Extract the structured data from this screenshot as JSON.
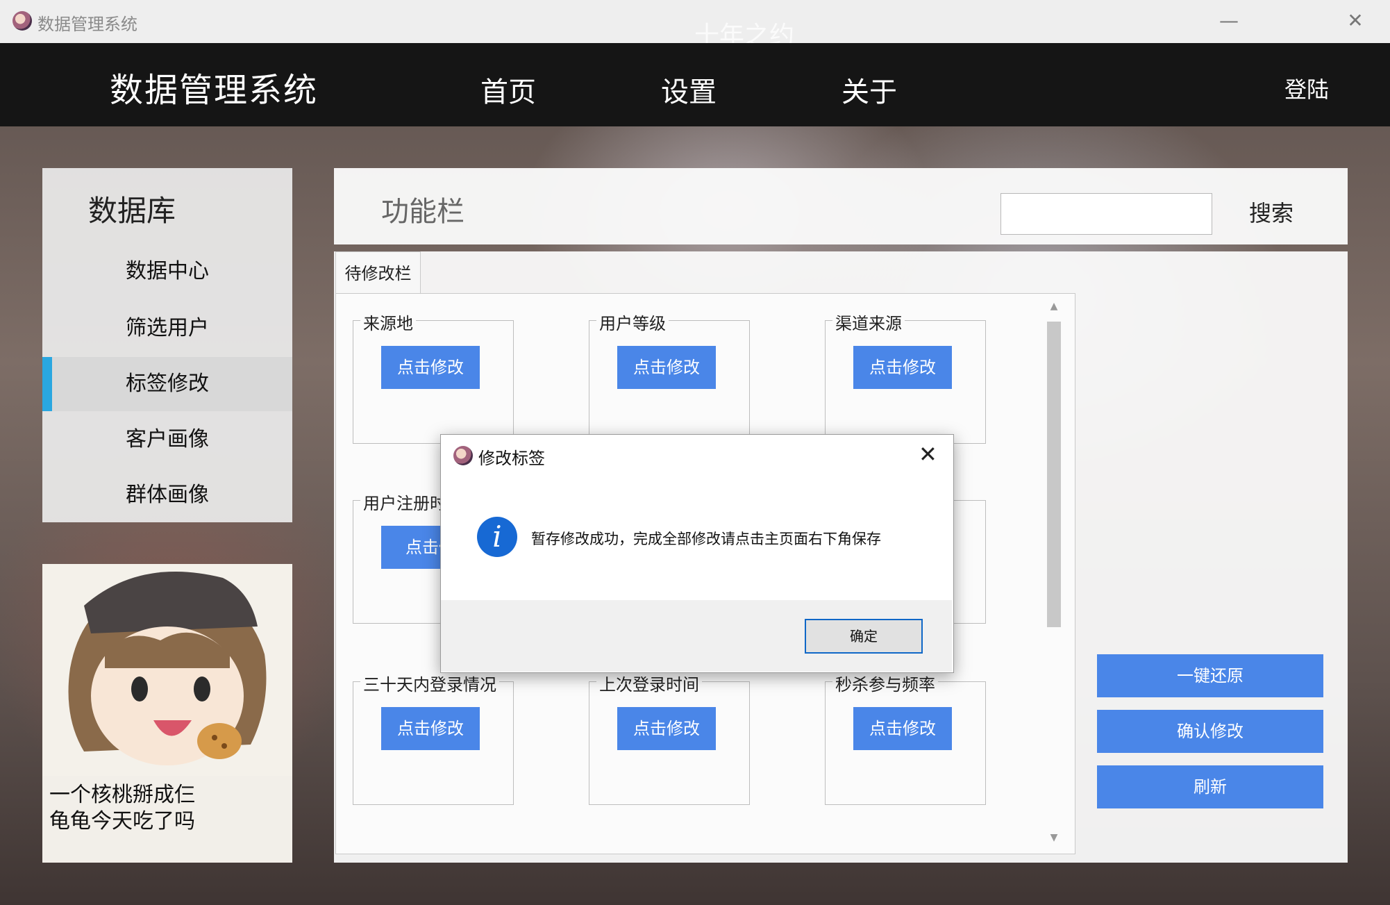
{
  "window": {
    "title": "数据管理系统",
    "background_title": "十年之约",
    "minimize_glyph": "—",
    "close_glyph": "✕"
  },
  "nav": {
    "brand": "数据管理系统",
    "items": [
      {
        "label": "首页"
      },
      {
        "label": "设置"
      },
      {
        "label": "关于"
      }
    ],
    "login_label": "登陆"
  },
  "sidebar": {
    "title": "数据库",
    "items": [
      {
        "label": "数据中心",
        "active": false
      },
      {
        "label": "筛选用户",
        "active": false
      },
      {
        "label": "标签修改",
        "active": true
      },
      {
        "label": "客户画像",
        "active": false
      },
      {
        "label": "群体画像",
        "active": false
      }
    ],
    "accent_color": "#2aa7e0"
  },
  "avatar_card": {
    "caption_line1": "一个核桃掰成仨",
    "caption_line2": "龟龟今天吃了吗"
  },
  "function_bar": {
    "title": "功能栏",
    "search_value": "",
    "search_button": "搜索"
  },
  "main": {
    "tab_label": "待修改栏",
    "groups": [
      {
        "label": "来源地",
        "button": "点击修改"
      },
      {
        "label": "用户等级",
        "button": "点击修改"
      },
      {
        "label": "渠道来源",
        "button": "点击修改"
      },
      {
        "label": "用户注册时",
        "button": "点击修"
      },
      {
        "label": "三十天内登录情况",
        "button": "点击修改"
      },
      {
        "label": "上次登录时间",
        "button": "点击修改"
      },
      {
        "label": "秒杀参与频率",
        "button": "点击修改"
      }
    ],
    "actions": [
      {
        "label": "一键还原"
      },
      {
        "label": "确认修改"
      },
      {
        "label": "刷新"
      }
    ],
    "button_color": "#4a86e8"
  },
  "dialog": {
    "title": "修改标签",
    "close_glyph": "✕",
    "info_glyph": "i",
    "message": "暂存修改成功，完成全部修改请点击主页面右下角保存",
    "ok_label": "确定"
  }
}
